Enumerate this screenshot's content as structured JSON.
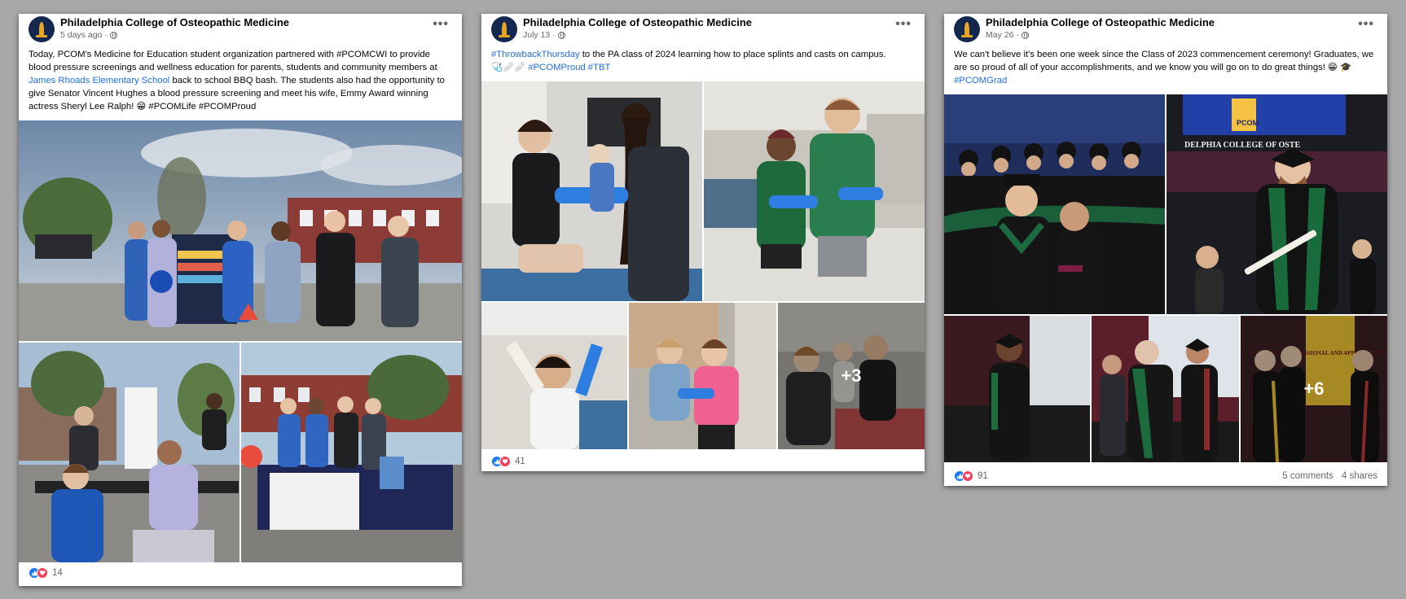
{
  "posts": [
    {
      "page_name": "Philadelphia College of Osteopathic Medicine",
      "time": "5 days ago",
      "text_1": "Today, PCOM's Medicine for Education student organization partnered with #PCOMCWI to provide blood pressure screenings and wellness education for parents, students and community members at ",
      "link": "James Rhoads Elementary School",
      "text_2": " back to school BBQ bash. The students also had the opportunity to give Senator Vincent Hughes a blood pressure screening and meet his wife, Emmy Award winning actress Sheryl Lee Ralph! 😁 #PCOMLife #PCOMProud",
      "reaction_count": "14"
    },
    {
      "page_name": "Philadelphia College of Osteopathic Medicine",
      "time": "July 13",
      "hashtag_lead": "#ThrowbackThursday",
      "text_1": " to the PA class of 2024 learning how to place splints and casts on campus.",
      "emoji": "🩺🩹🩹",
      "hashtags": "#PCOMProud #TBT",
      "more_photos": "+3",
      "reaction_count": "41"
    },
    {
      "page_name": "Philadelphia College of Osteopathic Medicine",
      "time": "May 26",
      "text_1": "We can't believe it's been one week since the Class of 2023 commencement ceremony! Graduates, we are so proud of all of your accomplishments, and we know you will go on to do great things! 😁 🎓 ",
      "hashtags": "#PCOMGrad",
      "more_photos": "+6",
      "reaction_count": "91",
      "comments": "5 comments",
      "shares": "4 shares",
      "banner_text": "PCOM",
      "banner_partial": "DELPHIA COLLEGE OF OSTE",
      "sign_text": "SCHOOL OF PROFESSIONAL AND APPLIED PSYCHOLOGY"
    }
  ],
  "ui": {
    "more_icon": "more-options-icon",
    "globe_icon": "public-globe-icon",
    "like_icon": "like-reaction-icon",
    "love_icon": "love-reaction-icon",
    "more_glyph": "•••"
  }
}
